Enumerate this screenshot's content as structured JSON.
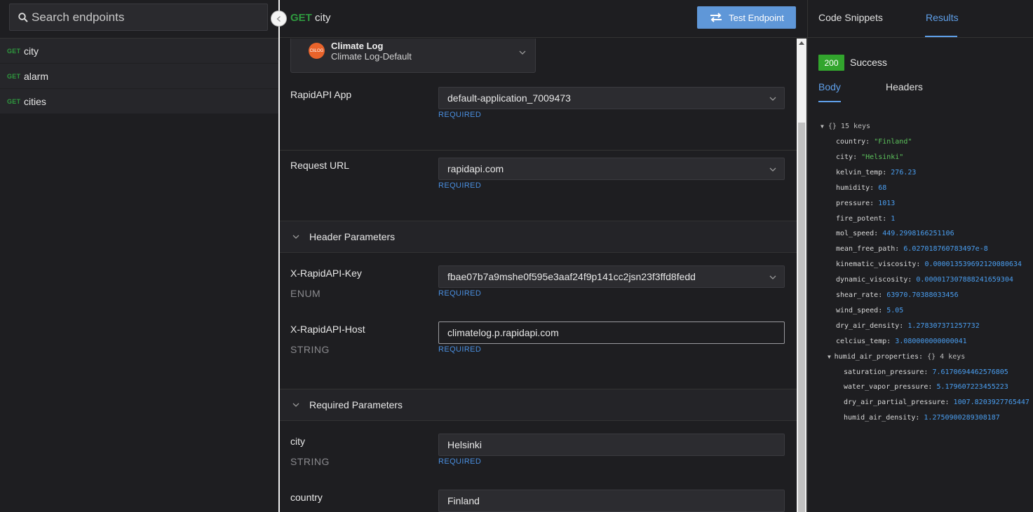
{
  "sidebar": {
    "search_placeholder": "Search endpoints",
    "endpoints": [
      {
        "method": "GET",
        "name": "city"
      },
      {
        "method": "GET",
        "name": "alarm"
      },
      {
        "method": "GET",
        "name": "cities"
      }
    ]
  },
  "header": {
    "method": "GET",
    "endpoint": "city",
    "test_button": "Test Endpoint"
  },
  "app_selector": {
    "logo_text": "CliLOG",
    "title": "Climate Log",
    "subtitle": "Climate Log-Default"
  },
  "form": {
    "rapidapi_app": {
      "label": "RapidAPI App",
      "value": "default-application_7009473",
      "required": "REQUIRED"
    },
    "request_url": {
      "label": "Request URL",
      "value": "rapidapi.com",
      "required": "REQUIRED"
    },
    "header_section": "Header Parameters",
    "x_rapidapi_key": {
      "label": "X-RapidAPI-Key",
      "type": "ENUM",
      "value": "fbae07b7a9mshe0f595e3aaf24f9p141cc2jsn23f3ffd8fedd",
      "required": "REQUIRED"
    },
    "x_rapidapi_host": {
      "label": "X-RapidAPI-Host",
      "type": "STRING",
      "value": "climatelog.p.rapidapi.com",
      "required": "REQUIRED"
    },
    "required_section": "Required Parameters",
    "city": {
      "label": "city",
      "type": "STRING",
      "value": "Helsinki",
      "required": "REQUIRED"
    },
    "country": {
      "label": "country",
      "value": "Finland"
    }
  },
  "results": {
    "tabs": {
      "snippets": "Code Snippets",
      "results": "Results"
    },
    "status_code": "200",
    "status_text": "Success",
    "body_tabs": {
      "body": "Body",
      "headers": "Headers"
    },
    "root_meta": "{}  15 keys",
    "fields": [
      {
        "key": "country:",
        "value": "\"Finland\"",
        "kind": "string"
      },
      {
        "key": "city:",
        "value": "\"Helsinki\"",
        "kind": "string"
      },
      {
        "key": "kelvin_temp:",
        "value": "276.23",
        "kind": "number"
      },
      {
        "key": "humidity:",
        "value": "68",
        "kind": "number"
      },
      {
        "key": "pressure:",
        "value": "1013",
        "kind": "number"
      },
      {
        "key": "fire_potent:",
        "value": "1",
        "kind": "number"
      },
      {
        "key": "mol_speed:",
        "value": "449.2998166251106",
        "kind": "number"
      },
      {
        "key": "mean_free_path:",
        "value": "6.027018760783497e-8",
        "kind": "number"
      },
      {
        "key": "kinematic_viscosity:",
        "value": "0.000013539692120080634",
        "kind": "number"
      },
      {
        "key": "dynamic_viscosity:",
        "value": "0.000017307888241659304",
        "kind": "number"
      },
      {
        "key": "shear_rate:",
        "value": "63970.70388033456",
        "kind": "number"
      },
      {
        "key": "wind_speed:",
        "value": "5.05",
        "kind": "number"
      },
      {
        "key": "dry_air_density:",
        "value": "1.278307371257732",
        "kind": "number"
      },
      {
        "key": "celcius_temp:",
        "value": "3.080000000000041",
        "kind": "number"
      }
    ],
    "nested_key": "humid_air_properties:",
    "nested_meta": "{}  4 keys",
    "nested_fields": [
      {
        "key": "saturation_pressure:",
        "value": "7.6170694462576805"
      },
      {
        "key": "water_vapor_pressure:",
        "value": "5.179607223455223"
      },
      {
        "key": "dry_air_partial_pressure:",
        "value": "1007.8203927765447"
      },
      {
        "key": "humid_air_density:",
        "value": "1.2750900289308187"
      }
    ]
  }
}
